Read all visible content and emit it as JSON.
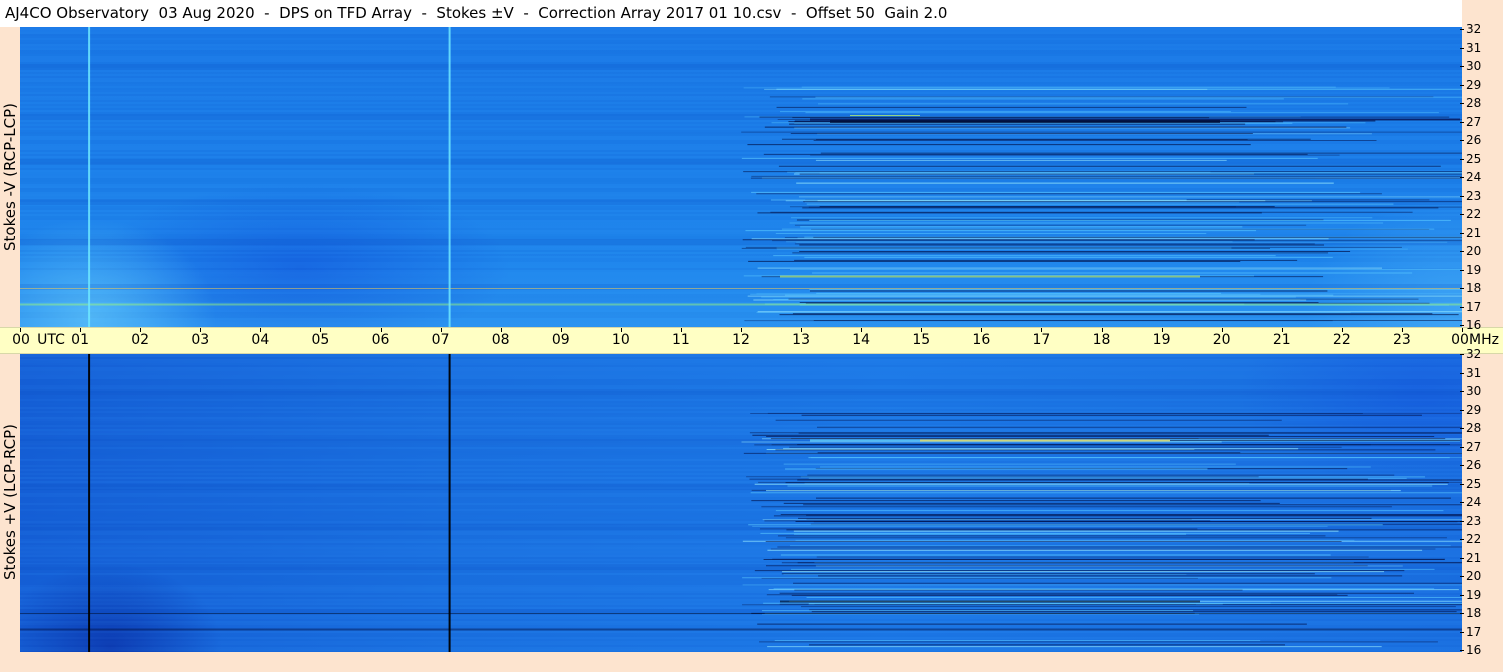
{
  "title": "AJ4CO Observatory  03 Aug 2020  -  DPS on TFD Array  -  Stokes ±V  -  Correction Array 2017 01 10.csv  -  Offset 50  Gain 2.0",
  "panels": {
    "top": {
      "label": "Stokes -V (RCP-LCP)"
    },
    "bottom": {
      "label": "Stokes +V (LCP-RCP)"
    }
  },
  "x_axis": {
    "unit_label": "UTC",
    "freq_unit": "MHz",
    "hours": [
      "00",
      "01",
      "02",
      "03",
      "04",
      "05",
      "06",
      "07",
      "08",
      "09",
      "10",
      "11",
      "12",
      "13",
      "14",
      "15",
      "16",
      "17",
      "18",
      "19",
      "20",
      "21",
      "22",
      "23",
      "00"
    ]
  },
  "y_axis": {
    "ticks": [
      "32",
      "31",
      "30",
      "29",
      "28",
      "27",
      "26",
      "25",
      "24",
      "23",
      "22",
      "21",
      "20",
      "19",
      "18",
      "17",
      "16"
    ]
  },
  "colors": {
    "background": "#fde4cf",
    "axis_band": "#ffffc4",
    "spectrogram_base": "#1a78e6"
  },
  "features": {
    "top_vertical_lines_utc": [
      1.15,
      7.15
    ],
    "bottom_vertical_lines_utc": [
      1.15,
      7.15
    ]
  }
}
